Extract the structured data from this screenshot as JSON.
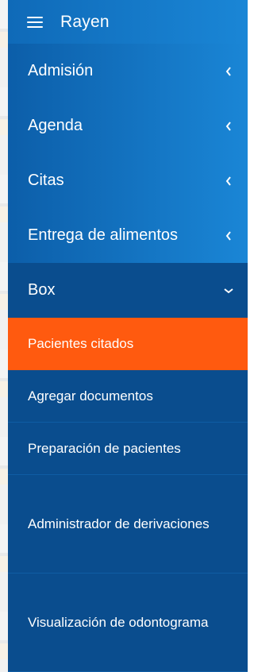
{
  "brand": {
    "title": "Rayen",
    "menu_icon": "hamburger-icon"
  },
  "menu": {
    "items": [
      {
        "label": "Admisión",
        "icon": "chevron-left-icon"
      },
      {
        "label": "Agenda",
        "icon": "chevron-left-icon"
      },
      {
        "label": "Citas",
        "icon": "chevron-left-icon"
      },
      {
        "label": "Entrega de alimentos",
        "icon": "chevron-left-icon"
      },
      {
        "label": "Box",
        "icon": "chevron-down-icon"
      }
    ],
    "box_submenu": [
      {
        "label": "Pacientes citados",
        "active": true
      },
      {
        "label": "Agregar documentos"
      },
      {
        "label": "Preparación de pacientes"
      },
      {
        "label": "Administrador de derivaciones"
      },
      {
        "label": "Visualización de odontograma"
      }
    ]
  },
  "colors": {
    "sidebar_bg": "#0b5396",
    "item_gradient_start": "#0c5ea9",
    "item_gradient_end": "#1a86d6",
    "open_item_bg": "#0a4d8e",
    "active_accent": "#ff5a0f",
    "text": "#ffffff"
  }
}
